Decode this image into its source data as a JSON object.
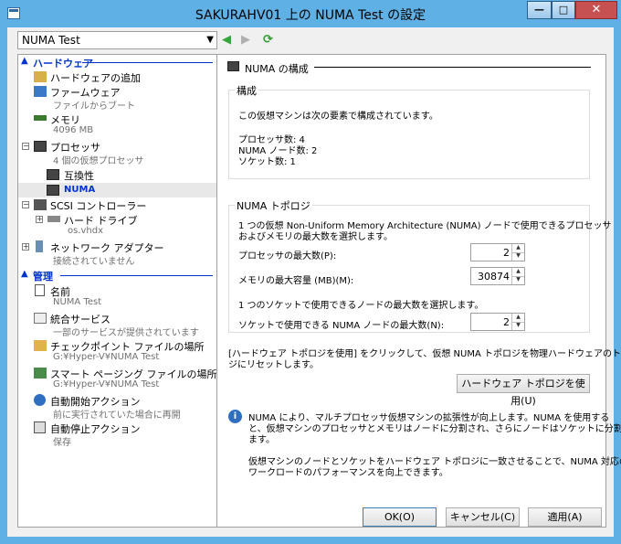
{
  "window": {
    "title": "SAKURAHV01 上の NUMA Test の設定",
    "min": "—",
    "max": "□",
    "close": "✕"
  },
  "vm_select": {
    "value": "NUMA Test"
  },
  "nav": {
    "back": "◀",
    "forward": "▶",
    "refresh": "⟳"
  },
  "sidebar": {
    "hardware_header": "ハードウェア",
    "management_header": "管理",
    "items": [
      {
        "label": "ハードウェアの追加"
      },
      {
        "label": "ファームウェア",
        "sub": "ファイルからブート"
      },
      {
        "label": "メモリ",
        "sub": "4096 MB"
      },
      {
        "label": "プロセッサ",
        "sub": "4 個の仮想プロセッサ"
      },
      {
        "label": "互換性"
      },
      {
        "label": "NUMA"
      },
      {
        "label": "SCSI コントローラー"
      },
      {
        "label": "ハード ドライブ",
        "sub": "os.vhdx"
      },
      {
        "label": "ネットワーク アダプター",
        "sub": "接続されていません"
      },
      {
        "label": "名前",
        "sub": "NUMA Test"
      },
      {
        "label": "統合サービス",
        "sub": "一部のサービスが提供されています"
      },
      {
        "label": "チェックポイント ファイルの場所",
        "sub": "G:¥Hyper-V¥NUMA Test"
      },
      {
        "label": "スマート ページング ファイルの場所",
        "sub": "G:¥Hyper-V¥NUMA Test"
      },
      {
        "label": "自動開始アクション",
        "sub": "前に実行されていた場合に再開"
      },
      {
        "label": "自動停止アクション",
        "sub": "保存"
      }
    ]
  },
  "panel": {
    "heading": "NUMA の構成",
    "config": {
      "title": "構成",
      "intro": "この仮想マシンは次の要素で構成されています。",
      "processors": "プロセッサ数: 4",
      "numa_nodes": "NUMA ノード数: 2",
      "sockets": "ソケット数: 1"
    },
    "topology": {
      "title": "NUMA トポロジ",
      "desc1": "1 つの仮想 Non-Uniform Memory Architecture (NUMA) ノードで使用できるプロセッサ",
      "desc2": "およびメモリの最大数を選択します。",
      "max_proc_label": "プロセッサの最大数(P):",
      "max_proc_value": "2",
      "max_mem_label": "メモリの最大容量 (MB)(M):",
      "max_mem_value": "30874",
      "socket_desc": "1 つのソケットで使用できるノードの最大数を選択します。",
      "max_nodes_label": "ソケットで使用できる NUMA ノードの最大数(N):",
      "max_nodes_value": "2"
    },
    "reset_text1": "[ハードウェア トポロジを使用] をクリックして、仮想 NUMA トポロジを物理ハードウェアのトポロ",
    "reset_text2": "ジにリセットします。",
    "hw_topology_button": "ハードウェア トポロジを使用(U)",
    "info": {
      "line1": "NUMA により、マルチプロセッサ仮想マシンの拡張性が向上します。NUMA を使用する",
      "line2": "と、仮想マシンのプロセッサとメモリはノードに分割され、さらにノードはソケットに分割され",
      "line3": "ます。",
      "line4": "仮想マシンのノードとソケットをハードウェア トポロジに一致させることで、NUMA 対応の",
      "line5": "ワークロードのパフォーマンスを向上できます。"
    }
  },
  "footer": {
    "ok": "OK(O)",
    "cancel": "キャンセル(C)",
    "apply": "適用(A)"
  },
  "colors": {
    "titlebar": "#5fb0e4",
    "header": "#0033cc",
    "selected_text": "#0033cc"
  }
}
